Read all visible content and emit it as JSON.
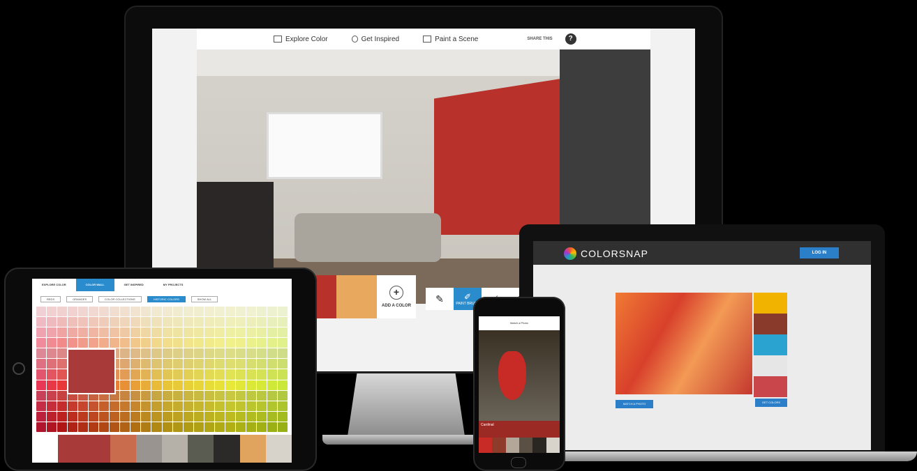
{
  "desktop": {
    "nav": [
      {
        "label": "Explore Color",
        "icon": "palette-icon"
      },
      {
        "label": "Get Inspired",
        "icon": "lightbulb-icon"
      },
      {
        "label": "Paint a Scene",
        "icon": "paint-icon"
      }
    ],
    "share_label": "SHARE THIS",
    "help_label": "?",
    "active_tool_label": "PAINT BRUSH",
    "add_color_label": "ADD A COLOR",
    "palette_colors": [
      "#b8322b",
      "#b8322b",
      "#e8a85d"
    ]
  },
  "laptop": {
    "brand": "COLORSNAP",
    "signin_label": "LOG IN",
    "swatch_colors": [
      "#f2b200",
      "#8a3a2a",
      "#2aa3d0",
      "#e6e6e6",
      "#c9474b"
    ],
    "button_left": "MATCH A PHOTO",
    "button_right": "GET COLORS"
  },
  "tablet": {
    "tabs": [
      {
        "label": "EXPLORE COLOR",
        "active": false
      },
      {
        "label": "COLOR WALL",
        "active": true
      },
      {
        "label": "GET INSPIRED",
        "active": false
      },
      {
        "label": "MY PROJECTS",
        "active": false
      }
    ],
    "filters": [
      {
        "label": "REDS",
        "selected": false
      },
      {
        "label": "ORANGES",
        "selected": false
      },
      {
        "label": "COLOR COLLECTIONS",
        "selected": false
      },
      {
        "label": "HISTORIC COLORS",
        "selected": true
      },
      {
        "label": "SHOW ALL",
        "selected": false
      }
    ],
    "palette_colors": [
      "#ffffff",
      "#a83a3a",
      "#c96b4d",
      "#9a9490",
      "#b5b0a8",
      "#5a5c52",
      "#2b2a28",
      "#e0a45f",
      "#d7d2ca"
    ]
  },
  "phone": {
    "title": "Match a Photo",
    "label": "Cardinal",
    "palette_colors": [
      "#c82a25",
      "#8e3b2c",
      "#b3a79a",
      "#5b5044",
      "#2a2722",
      "#d9d4cb"
    ]
  }
}
